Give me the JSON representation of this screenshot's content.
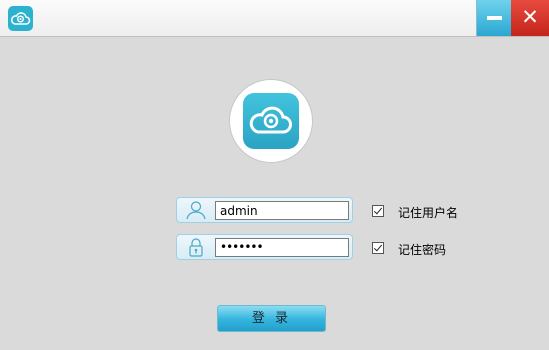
{
  "window": {
    "app_icon": "cloud-eye-icon",
    "minimize_icon": "minimize-icon",
    "close_icon": "close-icon",
    "close_glyph": "✕"
  },
  "logo": {
    "icon": "cloud-eye-logo-icon"
  },
  "login_form": {
    "username": {
      "value": "admin",
      "icon": "user-icon"
    },
    "password": {
      "value": "•••••••",
      "icon": "lock-icon"
    },
    "remember_username": {
      "label": "记住用户名",
      "checked": true
    },
    "remember_password": {
      "label": "记住密码",
      "checked": true
    },
    "login_button_label": "登 录"
  },
  "colors": {
    "accent": "#2cb1ce",
    "close_red": "#d6362b",
    "minimize_blue": "#3fb4da",
    "background": "#dadada"
  }
}
